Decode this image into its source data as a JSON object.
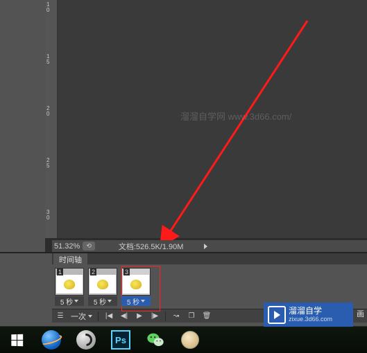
{
  "ruler": {
    "ticks": [
      "1\n0",
      "1\n5",
      "2\n0",
      "2\n5",
      "3\n0"
    ]
  },
  "status": {
    "zoom": "51.32%",
    "doc_label": "文档:526.5K/1.90M"
  },
  "timeline": {
    "tab_label": "时间轴",
    "frames": [
      {
        "num": "1",
        "delay": "5 秒"
      },
      {
        "num": "2",
        "delay": "5 秒"
      },
      {
        "num": "3",
        "delay": "5 秒"
      }
    ],
    "loop_label": "一次"
  },
  "banner": {
    "title": "溜溜自学",
    "sub": "zixue.3d66.com"
  },
  "quality_label": "画",
  "ps_label": "Ps",
  "watermark": "溜溜自学网 www.3d66.com/"
}
